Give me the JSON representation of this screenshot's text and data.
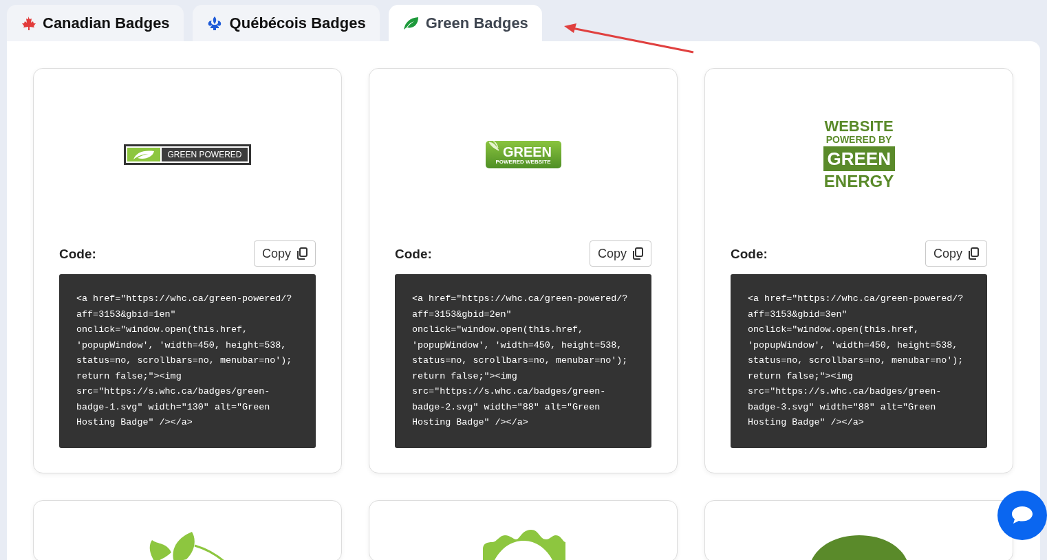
{
  "tabs": [
    {
      "label": "Canadian Badges",
      "kind": "maple",
      "selected": false
    },
    {
      "label": "Québécois Badges",
      "kind": "fleur",
      "selected": false
    },
    {
      "label": "Green Badges",
      "kind": "leaf",
      "selected": true
    }
  ],
  "cards": [
    {
      "badge": {
        "kind": "bar",
        "texts": [
          "GREEN POWERED"
        ]
      },
      "code_label": "Code:",
      "copy_label": "Copy",
      "code_lines": [
        "<a href=\"https://whc.ca/green-powered/?",
        "aff=3153&gbid=1en\"",
        "onclick=\"window.open(this.href,",
        "'popupWindow', 'width=450, height=538,",
        "status=no, scrollbars=no, menubar=no');",
        "return false;\"><img",
        "src=\"https://s.whc.ca/badges/green-",
        "badge-1.svg\" width=\"130\" alt=\"Green",
        "Hosting Badge\" /></a>"
      ]
    },
    {
      "badge": {
        "kind": "pill",
        "texts": [
          "GREEN",
          "POWERED WEBSITE"
        ]
      },
      "code_label": "Code:",
      "copy_label": "Copy",
      "code_lines": [
        "<a href=\"https://whc.ca/green-powered/?",
        "aff=3153&gbid=2en\"",
        "onclick=\"window.open(this.href,",
        "'popupWindow', 'width=450, height=538,",
        "status=no, scrollbars=no, menubar=no');",
        "return false;\"><img",
        "src=\"https://s.whc.ca/badges/green-",
        "badge-2.svg\" width=\"88\" alt=\"Green",
        "Hosting Badge\" /></a>"
      ]
    },
    {
      "badge": {
        "kind": "stack",
        "texts": [
          "WEBSITE",
          "POWERED BY",
          "GREEN",
          "ENERGY"
        ]
      },
      "code_label": "Code:",
      "copy_label": "Copy",
      "code_lines": [
        "<a href=\"https://whc.ca/green-powered/?",
        "aff=3153&gbid=3en\"",
        "onclick=\"window.open(this.href,",
        "'popupWindow', 'width=450, height=538,",
        "status=no, scrollbars=no, menubar=no');",
        "return false;\"><img",
        "src=\"https://s.whc.ca/badges/green-",
        "badge-3.svg\" width=\"88\" alt=\"Green",
        "Hosting Badge\" /></a>"
      ]
    },
    {
      "badge": {
        "kind": "leaves"
      }
    },
    {
      "badge": {
        "kind": "seal"
      }
    },
    {
      "badge": {
        "kind": "round"
      }
    }
  ]
}
